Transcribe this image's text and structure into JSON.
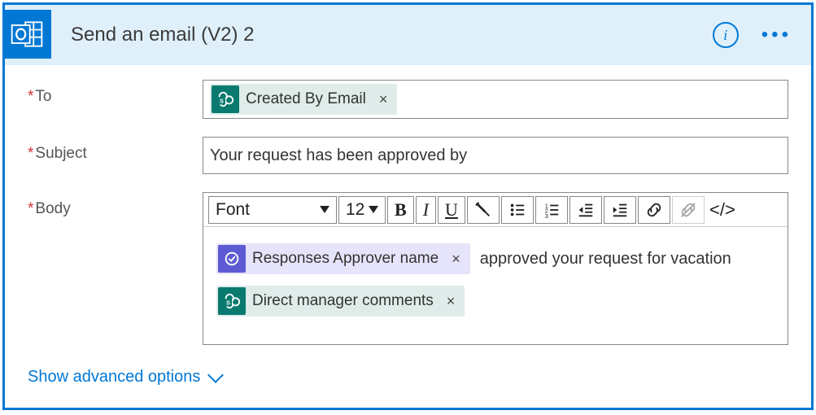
{
  "header": {
    "title": "Send an email (V2) 2"
  },
  "labels": {
    "to": "To",
    "subject": "Subject",
    "body": "Body"
  },
  "fields": {
    "to_token": {
      "label": "Created By Email",
      "source": "sharepoint"
    },
    "subject_value": "Your request has been approved by"
  },
  "toolbar": {
    "font_label": "Font",
    "size_label": "12"
  },
  "body_content": {
    "token1": {
      "label": "Responses Approver name",
      "source": "approvals"
    },
    "text1": "approved your request for vacation",
    "token2": {
      "label": "Direct manager comments",
      "source": "sharepoint"
    }
  },
  "footer": {
    "advanced_label": "Show advanced options"
  }
}
